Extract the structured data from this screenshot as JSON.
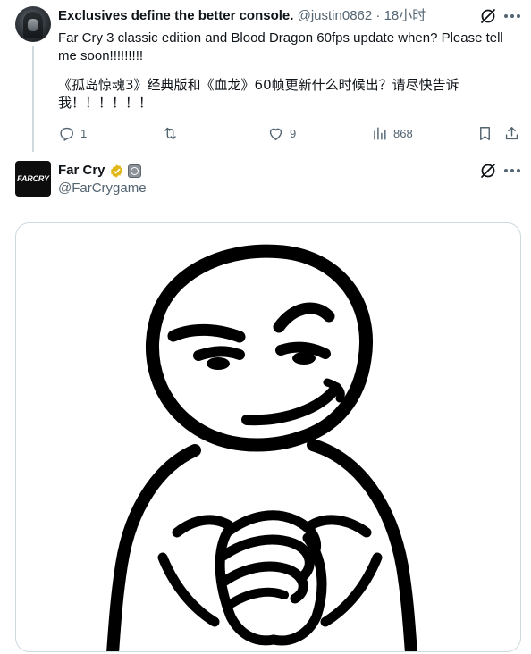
{
  "tweet": {
    "author_name": "Exclusives define the better console.",
    "author_handle": "@justin0862",
    "separator": " · ",
    "timestamp": "18小时",
    "text_en": "Far Cry 3 classic edition and Blood Dragon 60fps update when? Please tell me soon!!!!!!!!!",
    "text_zh": "《孤岛惊魂3》经典版和《血龙》60帧更新什么时候出？请尽快告诉我！！！！！！",
    "icons": {
      "avatar": "user-avatar",
      "grok": "grok-icon",
      "more": "more-icon"
    },
    "actions": {
      "reply": {
        "icon": "reply-icon",
        "count": "1"
      },
      "retweet": {
        "icon": "retweet-icon",
        "count": ""
      },
      "like": {
        "icon": "like-icon",
        "count": "9"
      },
      "views": {
        "icon": "views-icon",
        "count": "868"
      },
      "bookmark": {
        "icon": "bookmark-icon"
      },
      "share": {
        "icon": "share-icon"
      }
    }
  },
  "reply_tweet": {
    "author_name": "Far Cry",
    "author_handle": "@FarCrygame",
    "avatar_text": "FARCRY",
    "icons": {
      "verified": "verified-badge-icon",
      "affiliate": "affiliate-badge-icon",
      "grok": "grok-icon",
      "more": "more-icon"
    },
    "media": {
      "type": "image",
      "subject": "smug-face-meme"
    }
  },
  "colors": {
    "text_primary": "#0f1419",
    "text_secondary": "#536471",
    "border": "#cfd9de",
    "verified_gold": "#e2b719"
  }
}
